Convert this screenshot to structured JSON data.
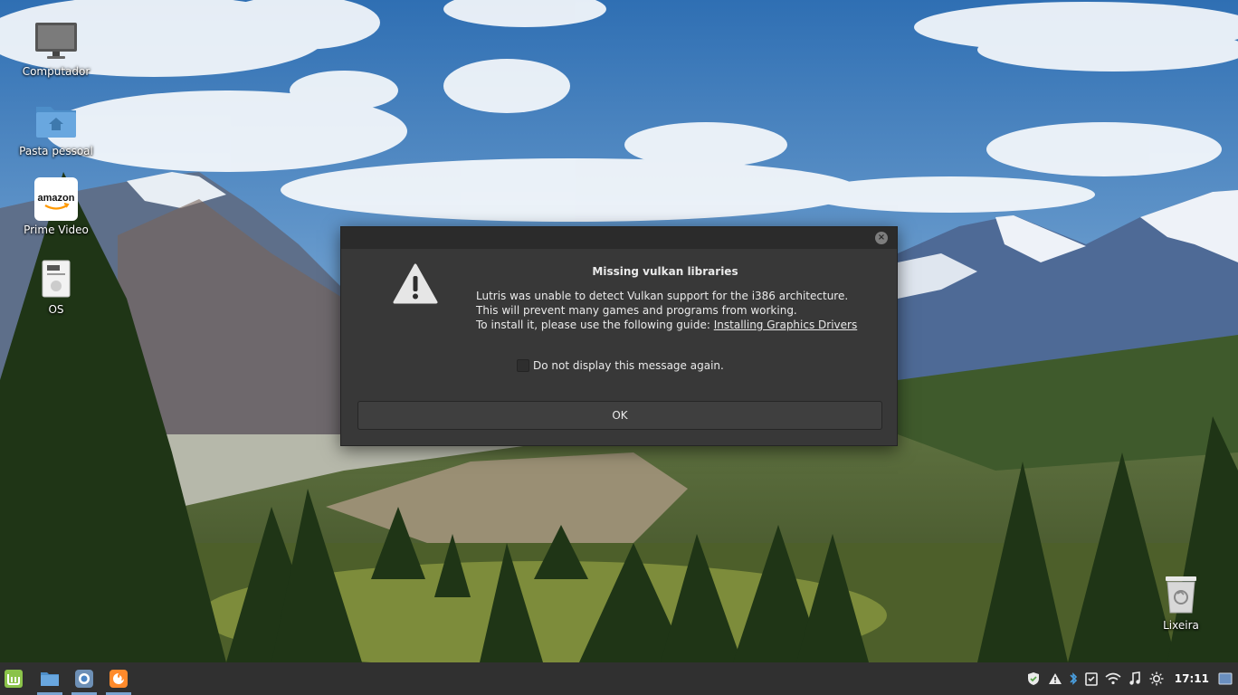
{
  "desktop": {
    "icons": [
      {
        "label": "Computador",
        "icon": "computer-icon"
      },
      {
        "label": "Pasta pessoal",
        "icon": "home-folder-icon"
      },
      {
        "label": "Prime Video",
        "icon": "amazon-app-icon",
        "logo_text": "amazon"
      },
      {
        "label": "OS",
        "icon": "document-icon"
      },
      {
        "label": "Lixeira",
        "icon": "trash-icon"
      }
    ]
  },
  "dialog": {
    "title": "Missing vulkan libraries",
    "line1": "Lutris was unable to detect Vulkan support for the i386 architecture.",
    "line2": "This will prevent many games and programs from working.",
    "line3_prefix": "To install it, please use the following guide: ",
    "link": "Installing Graphics Drivers",
    "checkbox_label": "Do not display this message again.",
    "checkbox_checked": false,
    "ok_label": "OK",
    "close_glyph": "×",
    "icon": "warning-icon"
  },
  "panel": {
    "launchers": [
      {
        "name": "menu-button",
        "icon": "mint-logo-icon"
      },
      {
        "name": "files-launcher",
        "icon": "folder-icon"
      },
      {
        "name": "chromium-launcher",
        "icon": "browser-icon"
      },
      {
        "name": "firefox-launcher",
        "icon": "firefox-icon"
      }
    ],
    "tray": [
      "shield-icon",
      "warning-icon",
      "bluetooth-icon",
      "clipboard-icon",
      "wifi-icon",
      "music-icon",
      "brightness-icon"
    ],
    "clock": "17:11"
  },
  "colors": {
    "dialog_bg": "#383838",
    "titlebar_bg": "#2b2b2b",
    "panel_bg": "#303030",
    "mint_green": "#8bc34a",
    "firefox_orange": "#ff8a2b"
  }
}
